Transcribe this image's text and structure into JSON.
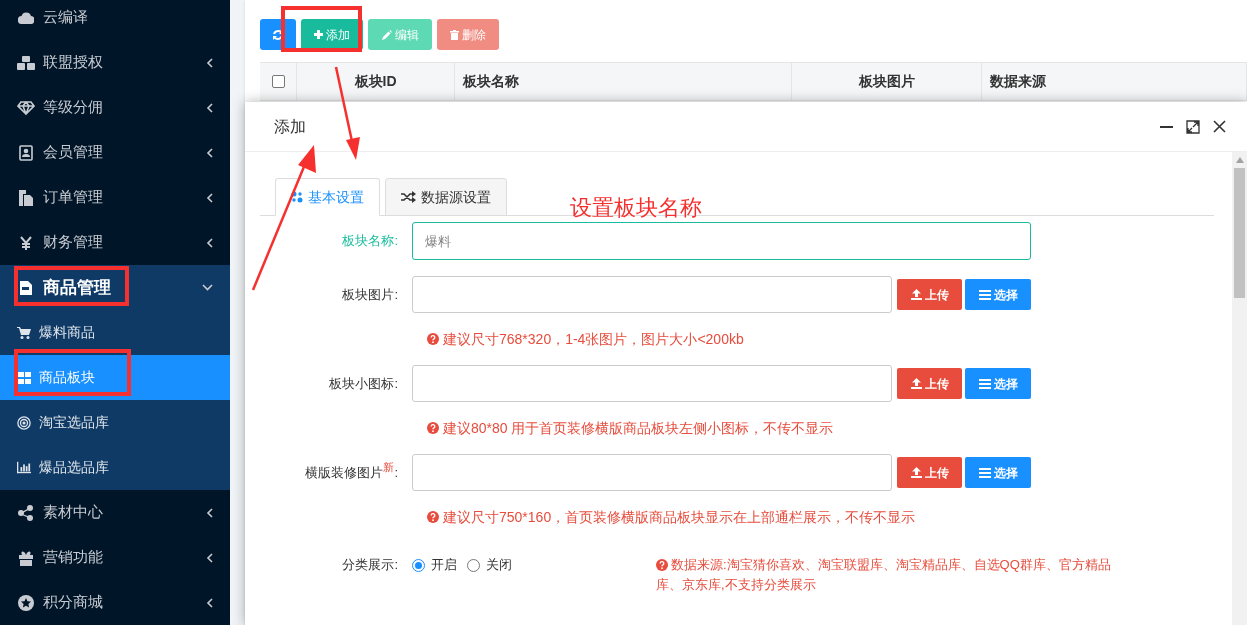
{
  "sidebar": {
    "items": [
      {
        "label": "云编译",
        "expandable": false,
        "expanded": false,
        "selected": false
      },
      {
        "label": "联盟授权",
        "expandable": true,
        "expanded": false,
        "selected": false
      },
      {
        "label": "等级分佣",
        "expandable": true,
        "expanded": false,
        "selected": false
      },
      {
        "label": "会员管理",
        "expandable": true,
        "expanded": false,
        "selected": false
      },
      {
        "label": "订单管理",
        "expandable": true,
        "expanded": false,
        "selected": false
      },
      {
        "label": "财务管理",
        "expandable": true,
        "expanded": false,
        "selected": false
      },
      {
        "label": "商品管理",
        "expandable": true,
        "expanded": true,
        "selected": false,
        "children": [
          {
            "label": "爆料商品",
            "selected": false
          },
          {
            "label": "商品板块",
            "selected": true
          },
          {
            "label": "淘宝选品库",
            "selected": false
          },
          {
            "label": "爆品选品库",
            "selected": false
          }
        ]
      },
      {
        "label": "素材中心",
        "expandable": true,
        "expanded": false,
        "selected": false
      },
      {
        "label": "营销功能",
        "expandable": true,
        "expanded": false,
        "selected": false
      },
      {
        "label": "积分商城",
        "expandable": true,
        "expanded": false,
        "selected": false
      }
    ]
  },
  "toolbar": [
    {
      "kind": "refresh",
      "disabled": false
    },
    {
      "kind": "add",
      "label": "添加",
      "disabled": false
    },
    {
      "kind": "edit",
      "label": "编辑",
      "disabled": true
    },
    {
      "kind": "delete",
      "label": "删除",
      "disabled": true
    }
  ],
  "table": {
    "columns": [
      "板块ID",
      "板块名称",
      "板块图片",
      "数据来源"
    ],
    "select_all_checked": false
  },
  "dialog": {
    "title": "添加",
    "tabs": [
      {
        "label": "基本设置",
        "selected": true
      },
      {
        "label": "数据源设置",
        "selected": false
      }
    ],
    "fields": [
      {
        "kind": "text",
        "label": "板块名称:",
        "focused": true,
        "placeholder": "爆料"
      },
      {
        "kind": "upload",
        "label": "板块图片:",
        "focused": false,
        "upload": "上传",
        "choose": "选择",
        "hint": "建议尺寸768*320，1-4张图片，图片大小<200kb"
      },
      {
        "kind": "upload",
        "label": "板块小图标:",
        "focused": false,
        "upload": "上传",
        "choose": "选择",
        "hint": "建议80*80 用于首页装修横版商品板块左侧小图标，不传不显示"
      },
      {
        "kind": "upload",
        "label": "横版装修图片$^{新}$:",
        "focused": false,
        "upload": "上传",
        "choose": "选择",
        "hint": "建议尺寸750*160，首页装修横版商品板块显示在上部通栏展示，不传不显示"
      },
      {
        "kind": "radio",
        "label": "分类展示:",
        "focused": false,
        "options": [
          {
            "label": "开启",
            "selected": true
          },
          {
            "label": "关闭",
            "selected": false
          }
        ],
        "note": "数据来源:淘宝猜你喜欢、淘宝联盟库、淘宝精品库、自选QQ群库、官方精品库、京东库,不支持分类展示"
      }
    ]
  },
  "annotations": {
    "note": "设置板块名称"
  }
}
